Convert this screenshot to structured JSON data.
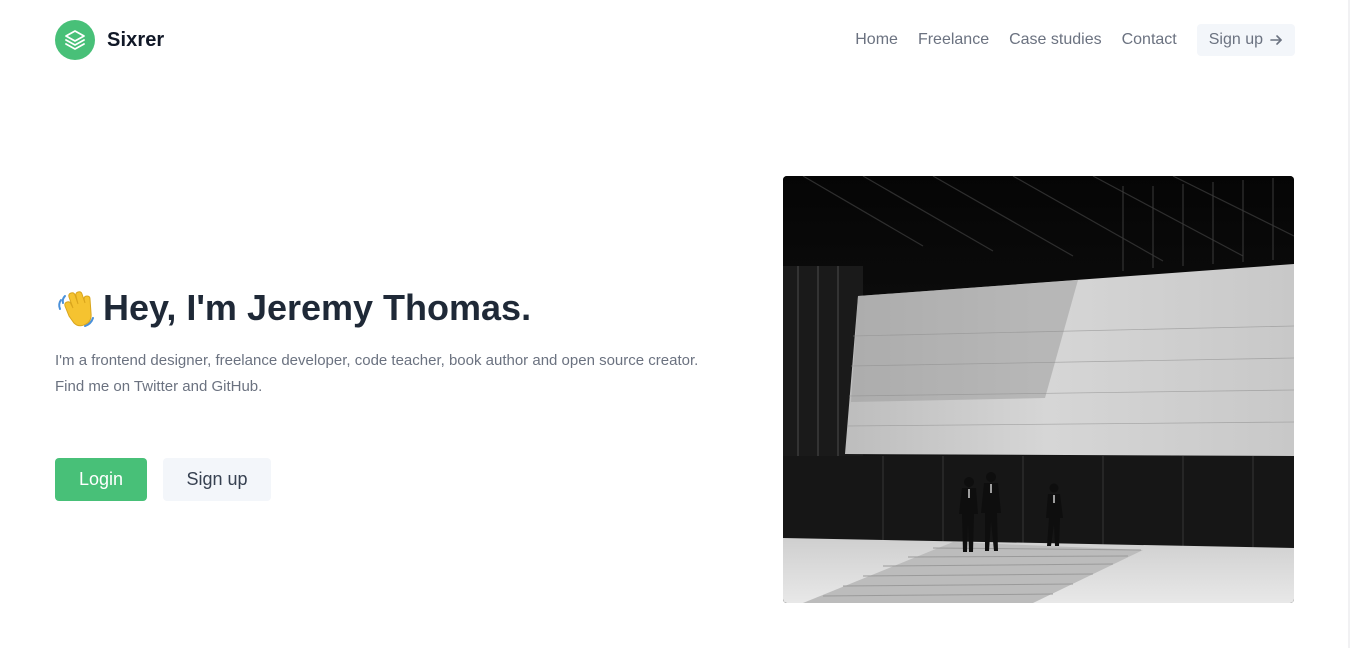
{
  "brand": {
    "name": "Sixrer",
    "logo_icon": "layers-icon",
    "logo_color": "#48c078"
  },
  "nav": {
    "links": [
      "Home",
      "Freelance",
      "Case studies",
      "Contact"
    ],
    "signup_label": "Sign up",
    "signup_icon": "arrow-right-icon"
  },
  "hero": {
    "wave_icon": "waving-hand-icon",
    "title": "Hey, I'm Jeremy Thomas.",
    "paragraph_line1": "I'm a frontend designer, freelance developer, code teacher, book author and open source creator.",
    "paragraph_line2": "Find me on Twitter and GitHub.",
    "login_label": "Login",
    "signup_label": "Sign up"
  },
  "image": {
    "alt": "black-and-white-architecture-photo",
    "description_icon": "photo"
  },
  "colors": {
    "accent": "#48c078",
    "text": "#1f2937",
    "muted": "#6b7280",
    "button_light": "#f3f6fa"
  }
}
